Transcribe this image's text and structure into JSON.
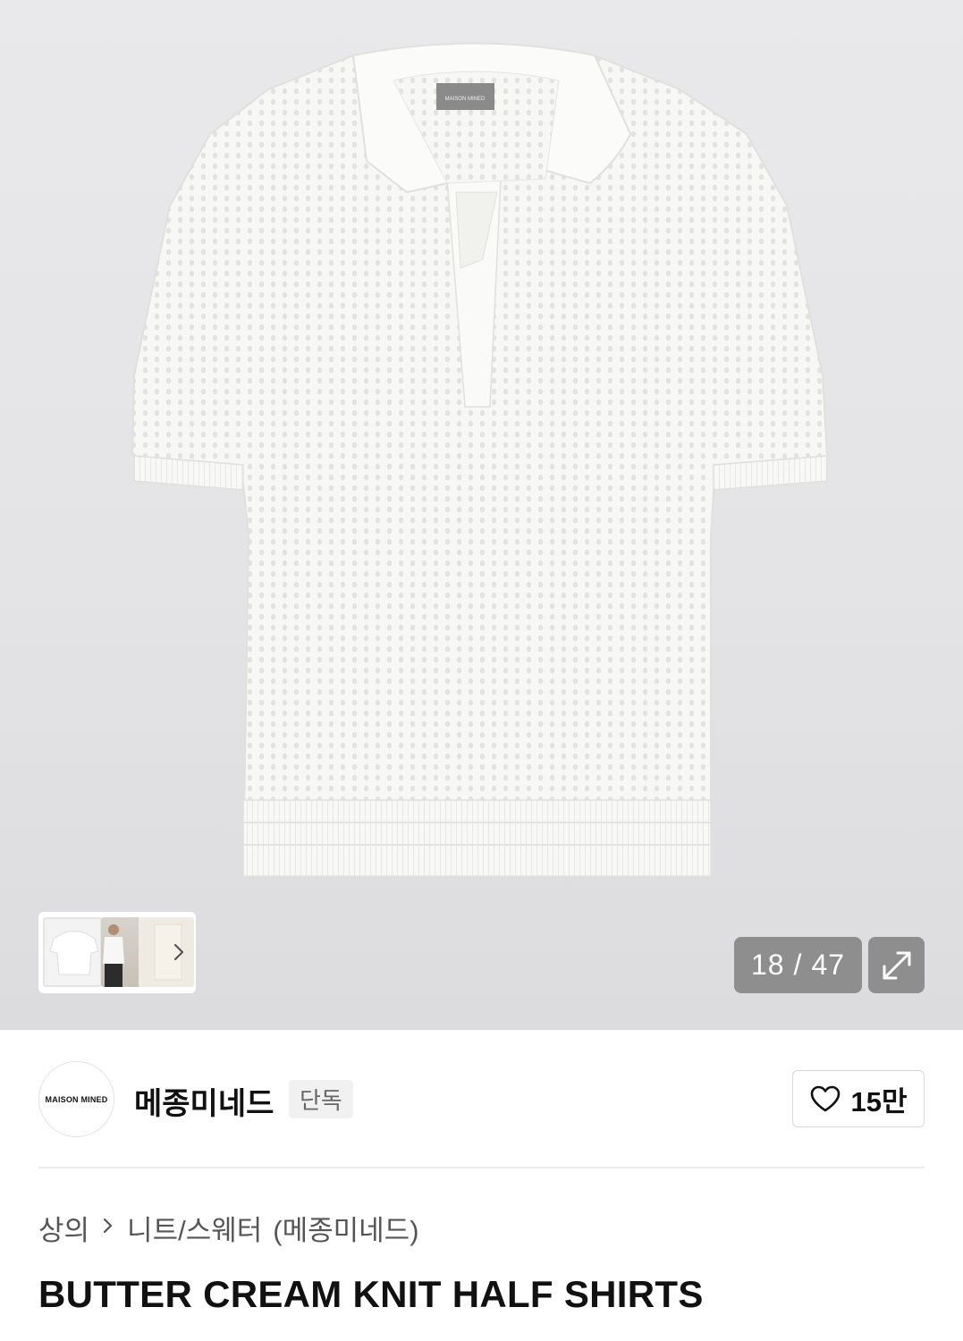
{
  "gallery": {
    "current": "18",
    "separator": "/",
    "total": "47",
    "label_tag_text": "MAISON MINED",
    "thumb_more_icon": "chevron-right-icon",
    "expand_icon": "expand-arrows-icon"
  },
  "brand": {
    "logo_text": "MAISON MINED",
    "name": "메종미네드",
    "badge": "단독",
    "like_icon": "heart-outline-icon",
    "like_count": "15만"
  },
  "breadcrumb": {
    "category": "상의",
    "subcategory": "니트/스웨터",
    "brand": "(메종미네드)"
  },
  "product": {
    "title": "BUTTER CREAM KNIT HALF SHIRTS"
  }
}
